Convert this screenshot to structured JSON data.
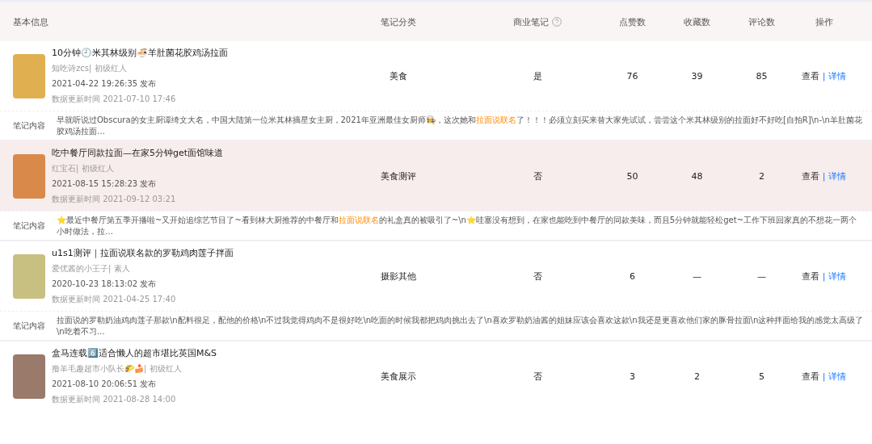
{
  "table": {
    "columns": [
      {
        "label": "基本信息",
        "help": false
      },
      {
        "label": "笔记分类",
        "help": false
      },
      {
        "label": "商业笔记",
        "help": true
      },
      {
        "label": "点赞数",
        "help": false
      },
      {
        "label": "收藏数",
        "help": false
      },
      {
        "label": "评论数",
        "help": false
      },
      {
        "label": "操作",
        "help": false
      }
    ],
    "rows": [
      {
        "highlighted": false,
        "title": "10分钟🕘米其林级别🍜羊肚菌花胶鸡汤拉面",
        "author": "知吃诗zcs| 初级红人",
        "published": "2021-04-22 19:26:35 发布",
        "updated": "数据更新时间 2021-07-10 17:46",
        "category": "美食",
        "commercial": "是",
        "likes": "76",
        "favorites": "39",
        "comments": "85",
        "view": "查看",
        "separator": "|",
        "details": "详情",
        "content_label": "笔记内容",
        "content": [
          {
            "text": "早就听说过Obscura的女主厨谭绮文大名，中国大陆第一位米其林摘星女主厨，2021年亚洲最佳女厨师👩‍🍳，这次她和",
            "highlight": false
          },
          {
            "text": "拉面说联名",
            "highlight": true
          },
          {
            "text": "了！！！必须立刻买来替大家先试试，尝尝这个米其林级别的拉面好不好吃[自拍R]\\n-\\n羊肚菌花胶鸡汤拉面…",
            "highlight": false
          }
        ]
      },
      {
        "highlighted": true,
        "title": "吃中餐厅同款拉面—在家5分钟get面馆味道",
        "author": "红宝石| 初级红人",
        "published": "2021-08-15 15:28:23 发布",
        "updated": "数据更新时间 2021-09-12 03:21",
        "category": "美食测评",
        "commercial": "否",
        "likes": "50",
        "favorites": "48",
        "comments": "2",
        "view": "查看",
        "separator": "|",
        "details": "详情",
        "content_label": "笔记内容",
        "content": [
          {
            "text": "⭐最近中餐厅第五季开播啦~又开始追综艺节目了~看到林大厨推荐的中餐厅和",
            "highlight": false
          },
          {
            "text": "拉面说联名",
            "highlight": true
          },
          {
            "text": "的礼盒真的被吸引了~\\n⭐哇塞没有想到，在家也能吃到中餐厅的同款美味，而且5分钟就能轻松get~工作下班回家真的不想花一两个小时做法，拉…",
            "highlight": false
          }
        ]
      },
      {
        "highlighted": false,
        "title": "u1s1测评｜拉面说联名款的罗勒鸡肉莲子拌面",
        "author": "爱优酱的小王子| 素人",
        "published": "2020-10-23 18:13:02 发布",
        "updated": "数据更新时间 2021-04-25 17:40",
        "category": "摄影其他",
        "commercial": "否",
        "likes": "6",
        "favorites": "—",
        "comments": "—",
        "view": "查看",
        "separator": "|",
        "details": "详情",
        "content_label": "笔记内容",
        "content": [
          {
            "text": "拉面说的罗勒奶油鸡肉莲子那款\\n配料很足，配他的价格\\n不过我觉得鸡肉不是很好吃\\n吃面的时候我都把鸡肉挑出去了\\n喜欢罗勒奶油酱的姐妹应该会喜欢这款\\n我还是更喜欢他们家的豚骨拉面\\n这种拌面给我的感觉太高级了\\n吃着不习…",
            "highlight": false
          }
        ]
      },
      {
        "highlighted": false,
        "title": "盒马连载6️⃣适合懒人的超市堪比英国M&S",
        "author": "撸羊毛趣超市小队长🌮🍰| 初级红人",
        "published": "2021-08-10 20:06:51 发布",
        "updated": "数据更新时间 2021-08-28 14:00",
        "category": "美食展示",
        "commercial": "否",
        "likes": "3",
        "favorites": "2",
        "comments": "5",
        "view": "查看",
        "separator": "|",
        "details": "详情"
      }
    ]
  }
}
